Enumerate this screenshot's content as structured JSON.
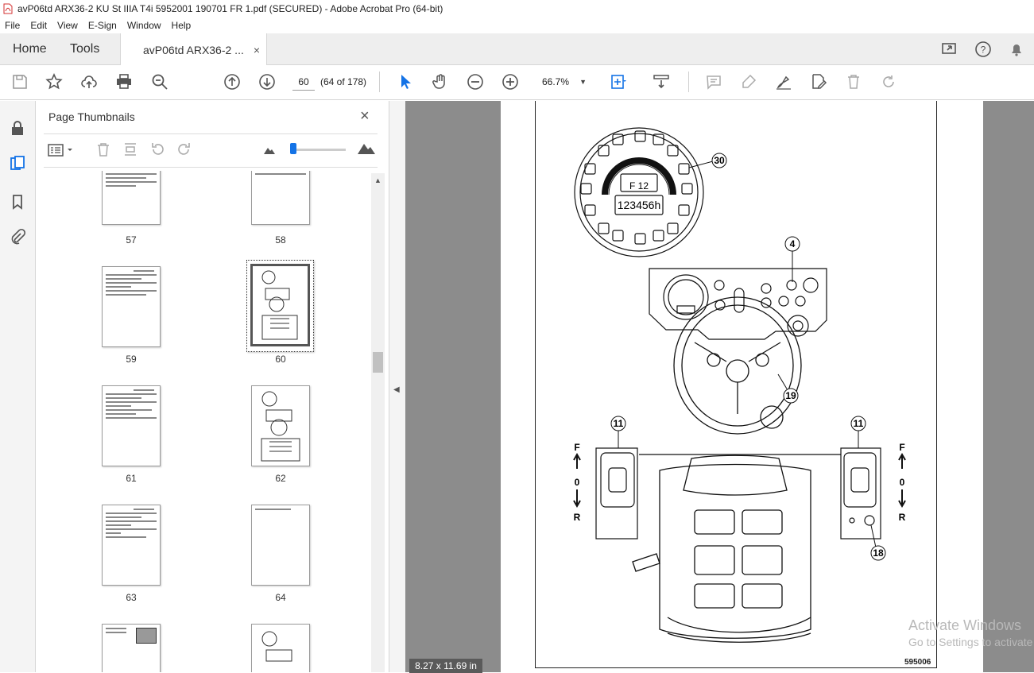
{
  "window": {
    "title": "avP06td ARX36-2 KU St IIIA T4i 5952001 190701 FR 1.pdf (SECURED) - Adobe Acrobat Pro (64-bit)"
  },
  "menu": [
    "File",
    "Edit",
    "View",
    "E-Sign",
    "Window",
    "Help"
  ],
  "tabs": {
    "home": "Home",
    "tools": "Tools",
    "document": "avP06td ARX36-2 ...",
    "document_close": "×"
  },
  "toolbar": {
    "page_current": "60",
    "page_count": "(64 of 178)",
    "zoom": "66.7%",
    "zoom_caret": "▼"
  },
  "panel": {
    "title": "Page Thumbnails",
    "close": "×",
    "thumbnails": [
      {
        "label": "57"
      },
      {
        "label": "58"
      },
      {
        "label": "59"
      },
      {
        "label": "60"
      },
      {
        "label": "61"
      },
      {
        "label": "62"
      },
      {
        "label": "63"
      },
      {
        "label": "64"
      },
      {
        "label": ""
      },
      {
        "label": ""
      }
    ]
  },
  "document": {
    "page_size": "8.27 x 11.69 in",
    "figure_id": "595006",
    "callouts": [
      "30",
      "4",
      "19",
      "11",
      "11",
      "18"
    ],
    "gear_labels_left": [
      "F",
      "0",
      "R"
    ],
    "gear_labels_right": [
      "F",
      "0",
      "R"
    ],
    "display_top": "F 12",
    "display_hours": "123456h"
  },
  "watermark": {
    "line1": "Activate Windows",
    "line2": "Go to Settings to activate Windows."
  }
}
